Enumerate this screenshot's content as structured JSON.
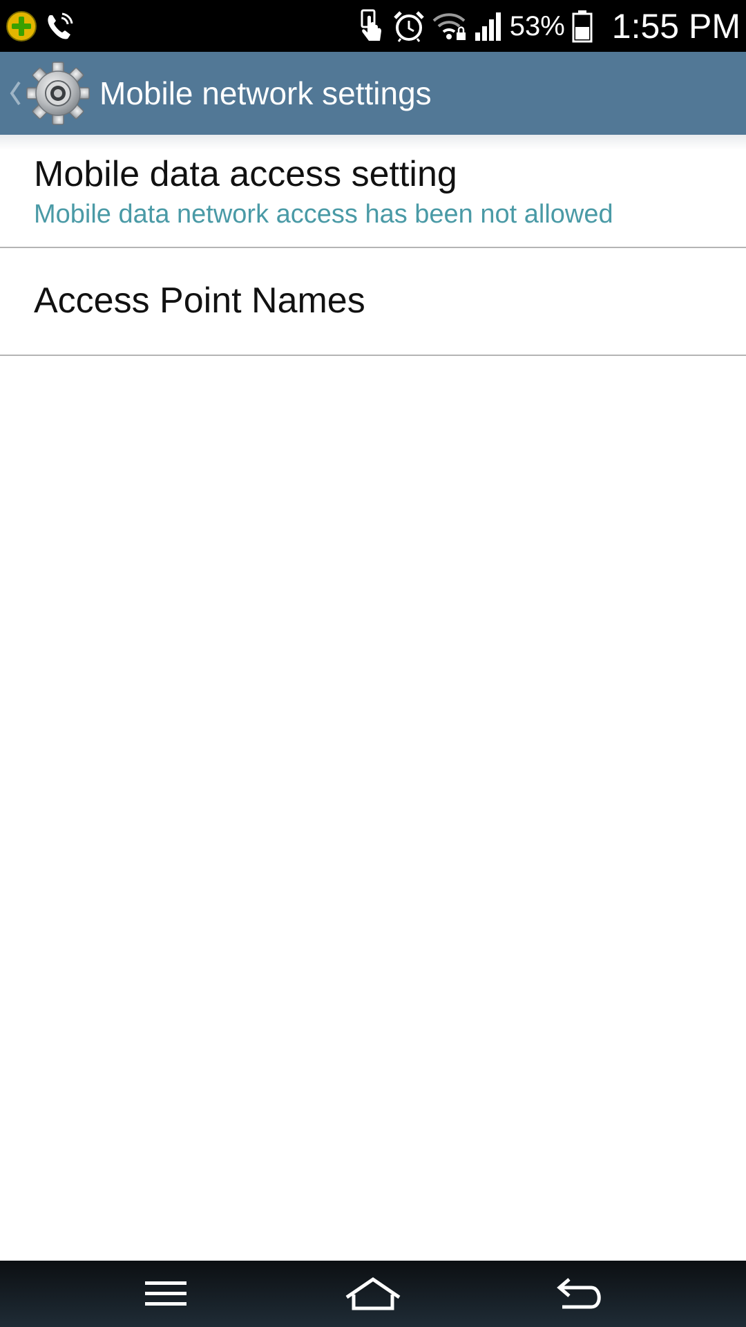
{
  "status_bar": {
    "left_icons": [
      "app-notification-icon",
      "phone-call-icon"
    ],
    "right_icons": [
      "touch-icon",
      "alarm-clock-icon",
      "wifi-locked-icon",
      "cell-signal-icon",
      "battery-icon"
    ],
    "battery_percent": "53%",
    "time": "1:55 PM"
  },
  "action_bar": {
    "title": "Mobile network settings",
    "icon": "settings-gear-icon",
    "background_color": "#527896"
  },
  "settings": {
    "items": [
      {
        "title": "Mobile data access setting",
        "summary": "Mobile data network access has been not allowed"
      },
      {
        "title": "Access Point Names"
      }
    ],
    "summary_color": "#4a9aa6"
  },
  "nav_bar": {
    "buttons": [
      "menu-icon",
      "home-icon",
      "back-icon"
    ]
  }
}
